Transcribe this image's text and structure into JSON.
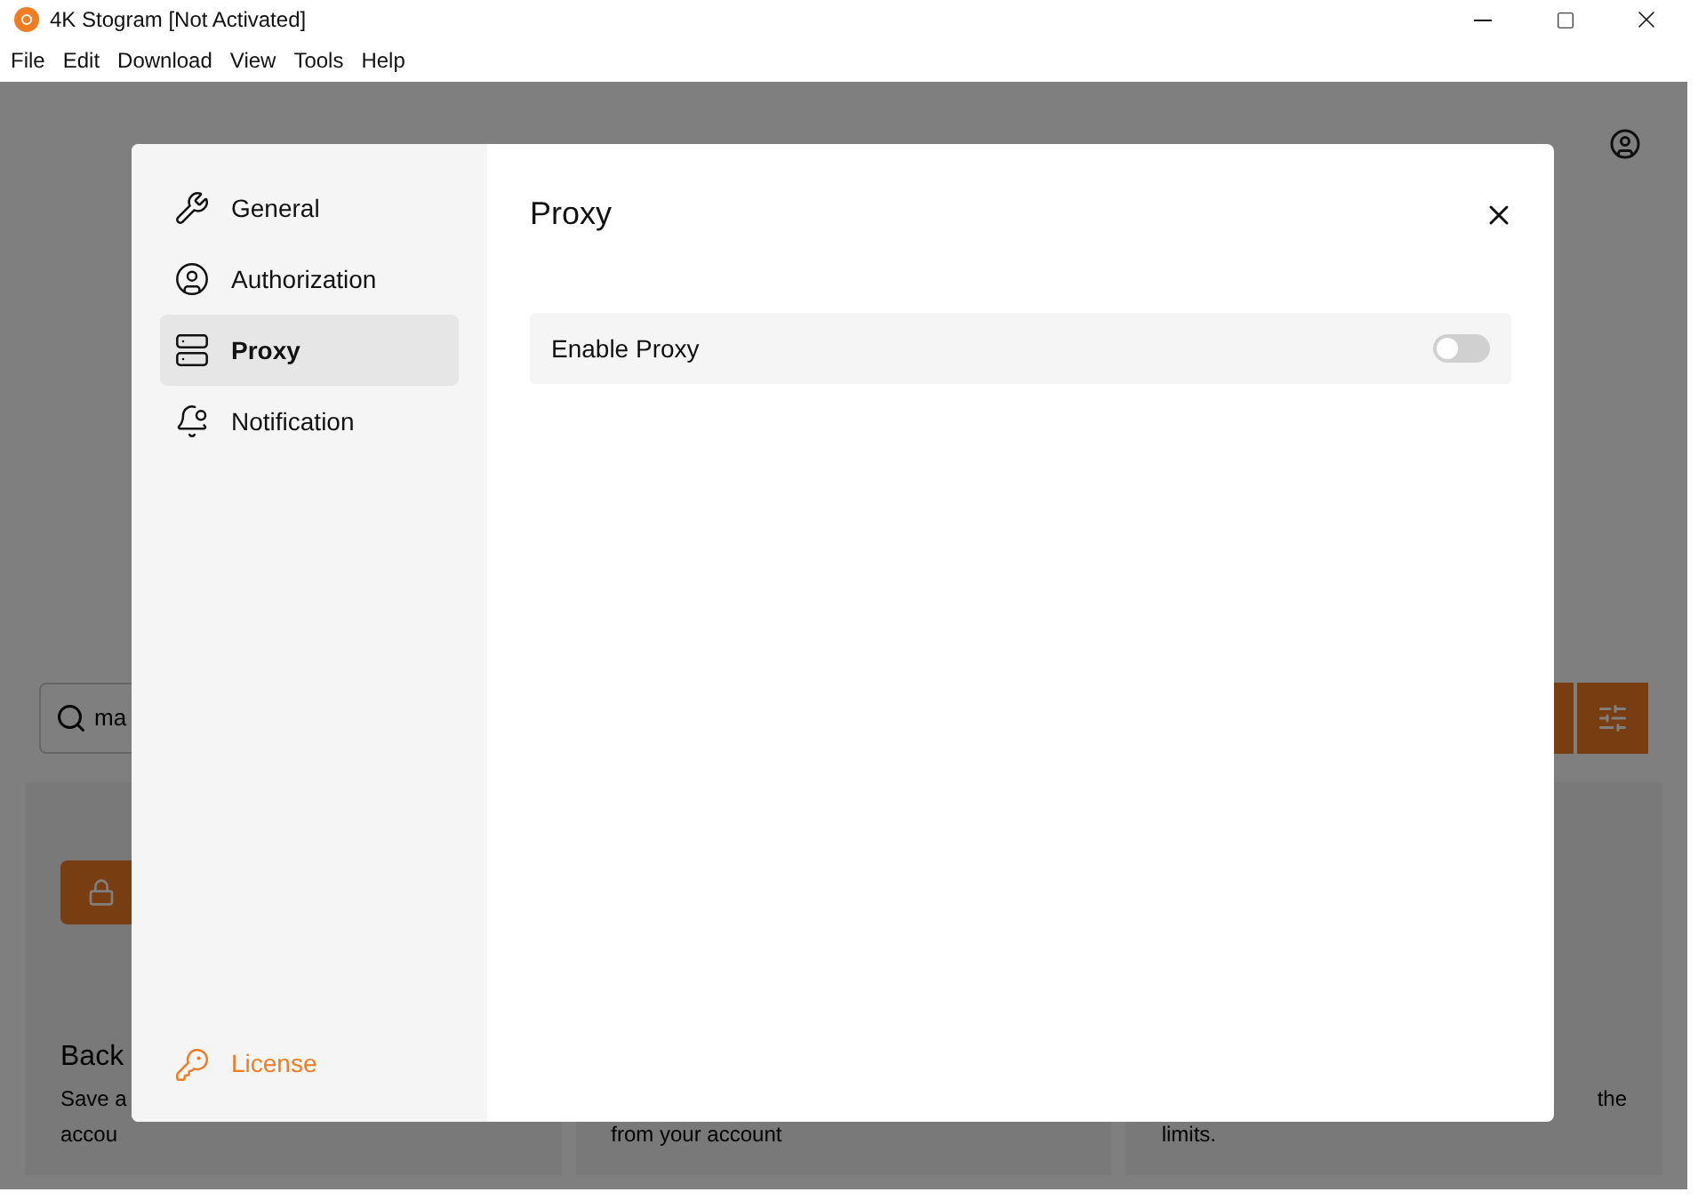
{
  "window": {
    "title": "4K Stogram [Not Activated]"
  },
  "menu": [
    "File",
    "Edit",
    "Download",
    "View",
    "Tools",
    "Help"
  ],
  "background": {
    "search": {
      "value": "ma"
    },
    "cards": [
      {
        "title": "Back",
        "lines": [
          "Save a",
          "accou"
        ]
      },
      {
        "lines": [
          "from your account"
        ]
      },
      {
        "lines": [
          "the",
          "limits."
        ]
      }
    ]
  },
  "dialog": {
    "title": "Proxy",
    "nav": [
      {
        "label": "General",
        "selected": false
      },
      {
        "label": "Authorization",
        "selected": false
      },
      {
        "label": "Proxy",
        "selected": true
      },
      {
        "label": "Notification",
        "selected": false
      }
    ],
    "license": "License",
    "settings": [
      {
        "label": "Enable Proxy",
        "on": false
      }
    ]
  }
}
